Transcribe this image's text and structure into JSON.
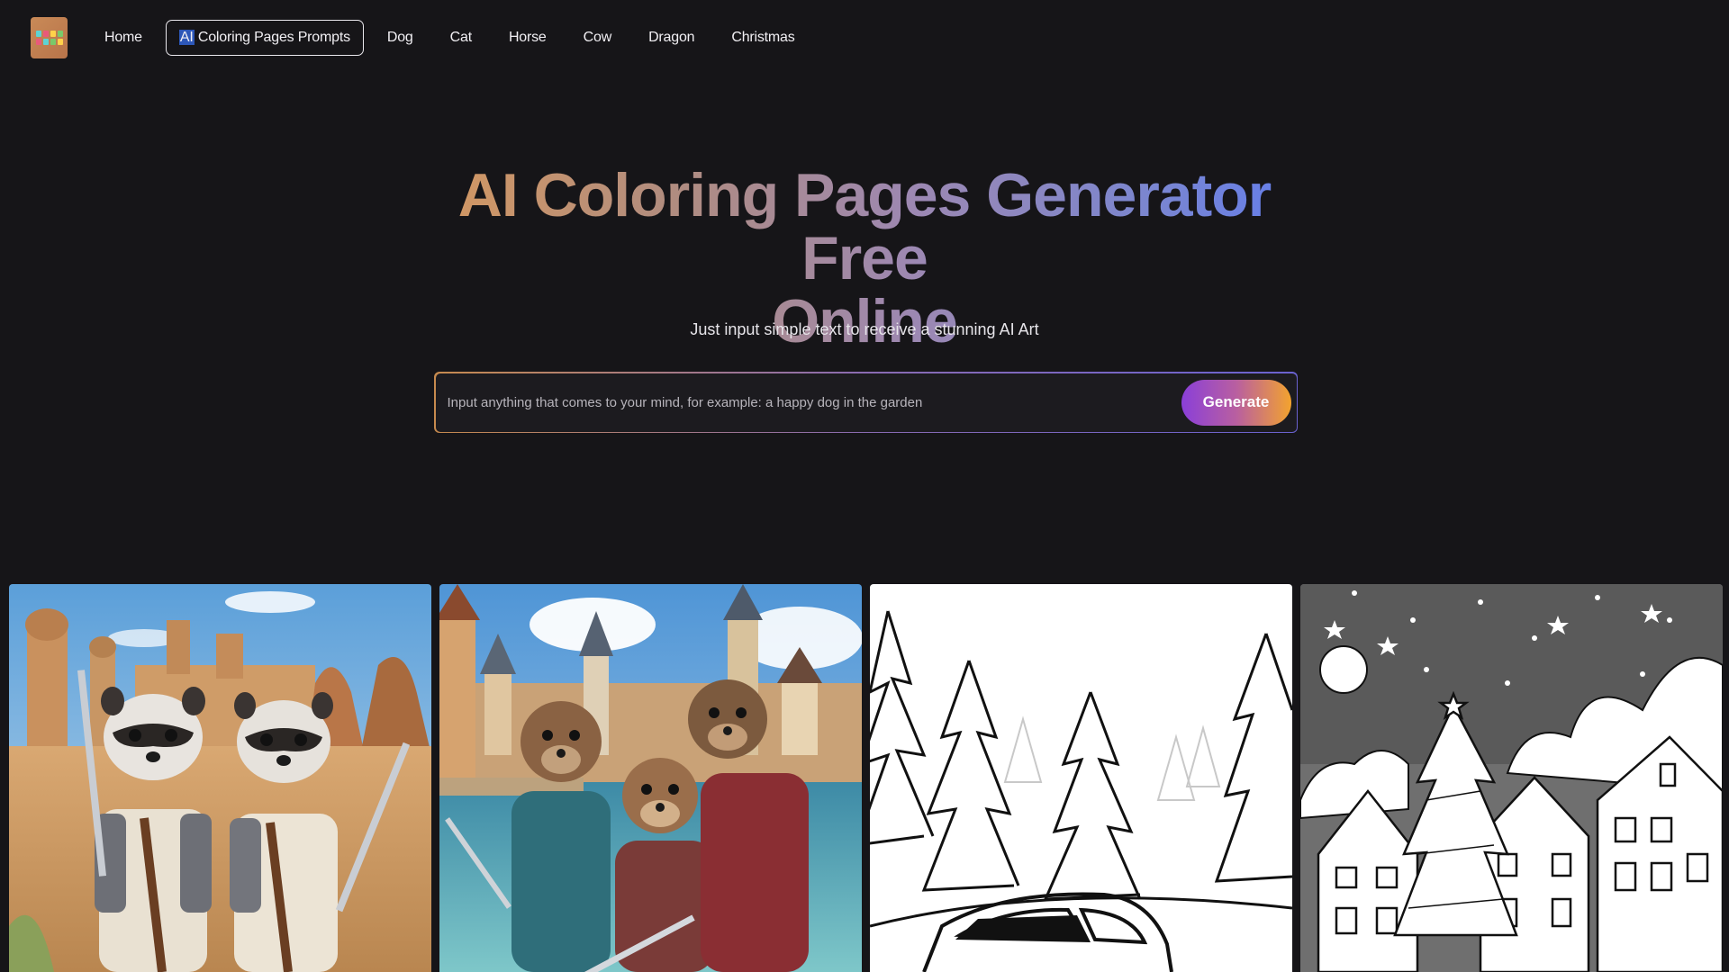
{
  "nav": {
    "logo_alt": "Coloring Pages logo",
    "items": [
      {
        "label": "Home",
        "active": false
      },
      {
        "label_sel": "AI",
        "label_rest": " Coloring Pages Prompts",
        "active": true
      },
      {
        "label": "Dog",
        "active": false
      },
      {
        "label": "Cat",
        "active": false
      },
      {
        "label": "Horse",
        "active": false
      },
      {
        "label": "Cow",
        "active": false
      },
      {
        "label": "Dragon",
        "active": false
      },
      {
        "label": "Christmas",
        "active": false
      }
    ]
  },
  "hero": {
    "title_line1": "AI Coloring Pages Generator Free",
    "title_line2": "Online",
    "subtitle": "Just input simple text to receive a stunning AI Art"
  },
  "search": {
    "value": "",
    "placeholder": "Input anything that comes to your mind, for example: a happy dog in the garden",
    "button_label": "Generate"
  },
  "gallery": {
    "cards": [
      {
        "name": "raccoon-knights-desert"
      },
      {
        "name": "otter-warriors-harbor"
      },
      {
        "name": "pine-trees-car-lineart"
      },
      {
        "name": "christmas-village-lineart"
      }
    ]
  },
  "colors": {
    "background": "#161518",
    "accent_orange": "#d99a5d",
    "accent_blue": "#5f7cf2",
    "button_purple": "#8a3fd9",
    "button_orange": "#f3a32e"
  }
}
